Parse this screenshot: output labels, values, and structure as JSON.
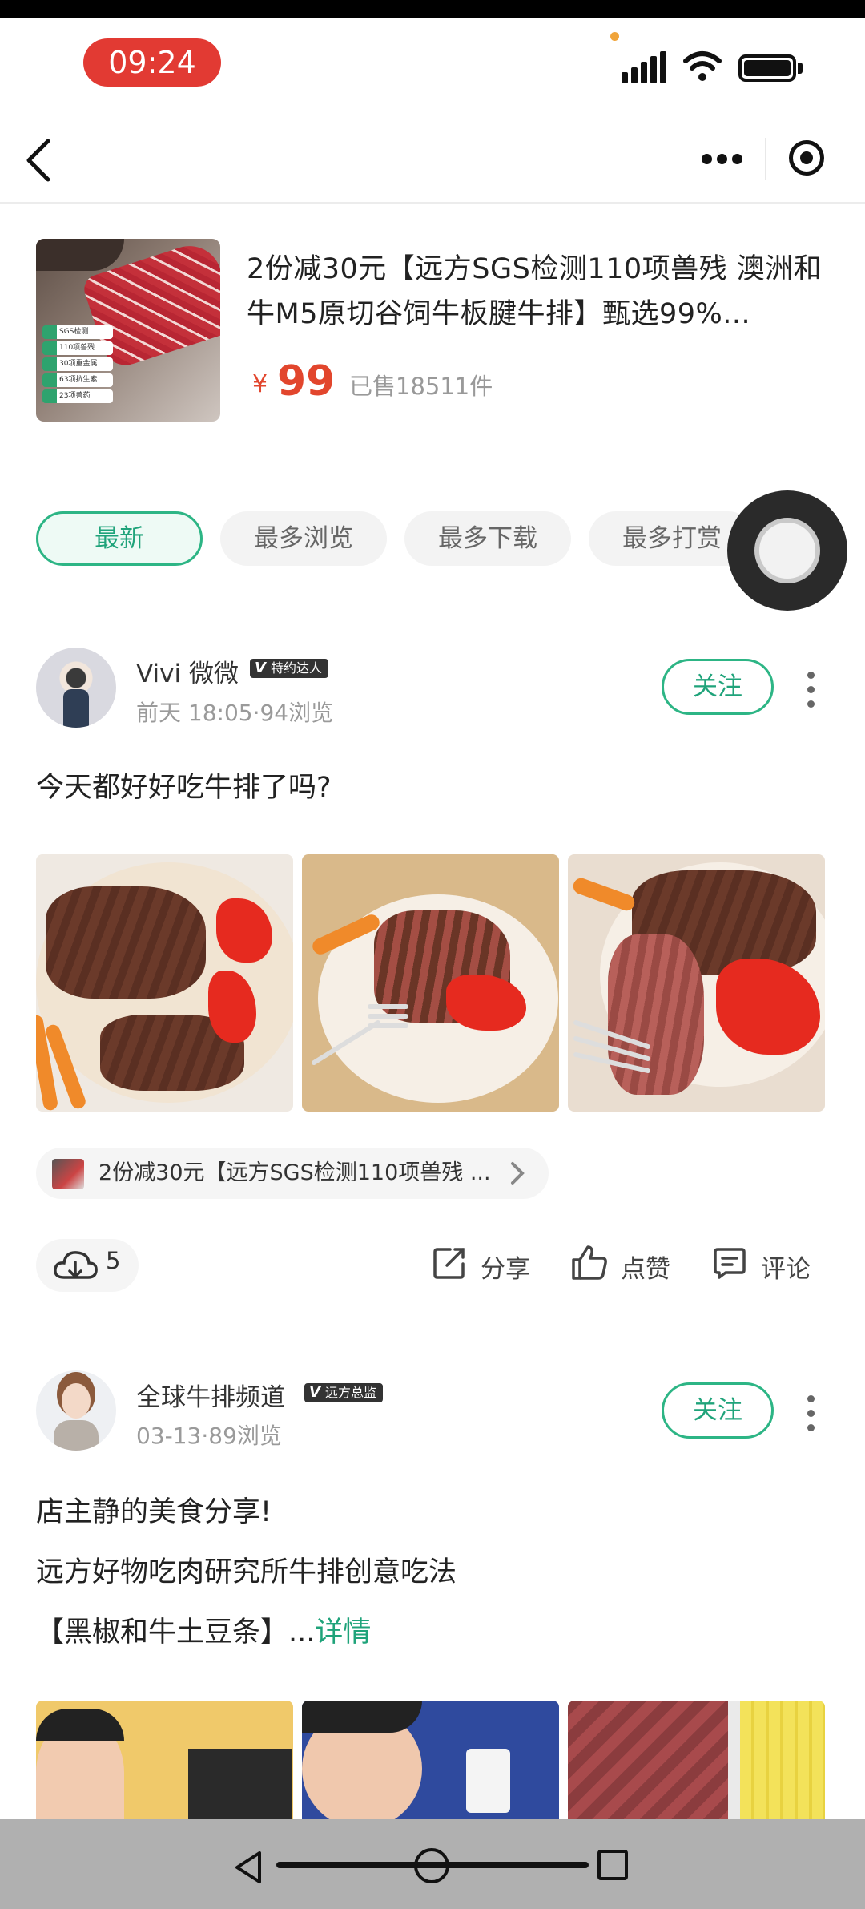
{
  "status_bar": {
    "time": "09:24"
  },
  "product": {
    "title": "2份减30元【远方SGS检测110项兽残 澳洲和牛M5原切谷饲牛板腱牛排】甄选99%...",
    "price_symbol": "¥",
    "price": "99",
    "sold": "已售18511件",
    "image_badges": [
      "SGS检测",
      "110项兽残",
      "30项重金属",
      "63项抗生素",
      "23项兽药"
    ]
  },
  "tabs": [
    {
      "label": "最新",
      "active": true
    },
    {
      "label": "最多浏览",
      "active": false
    },
    {
      "label": "最多下载",
      "active": false
    },
    {
      "label": "最多打赏",
      "active": false
    }
  ],
  "post1": {
    "user_name": "Vivi 微微",
    "badge": "特约达人",
    "meta": "前天 18:05·94浏览",
    "follow_label": "关注",
    "text": "今天都好好吃牛排了吗?",
    "link_text": "2份减30元【远方SGS检测110项兽残 ...",
    "download_count": "5",
    "share_label": "分享",
    "like_label": "点赞",
    "comment_label": "评论"
  },
  "post2": {
    "user_name": "全球牛排频道",
    "badge": "远方总监",
    "meta": "03-13·89浏览",
    "follow_label": "关注",
    "text_lines": [
      "店主静的美食分享!",
      "远方好物吃肉研究所牛排创意吃法"
    ],
    "text_line3": "【黑椒和牛土豆条】...",
    "detail_label": "详情"
  },
  "colors": {
    "accent_green": "#1fa37a",
    "price_red": "#e2462d",
    "time_pill": "#e23a33"
  }
}
